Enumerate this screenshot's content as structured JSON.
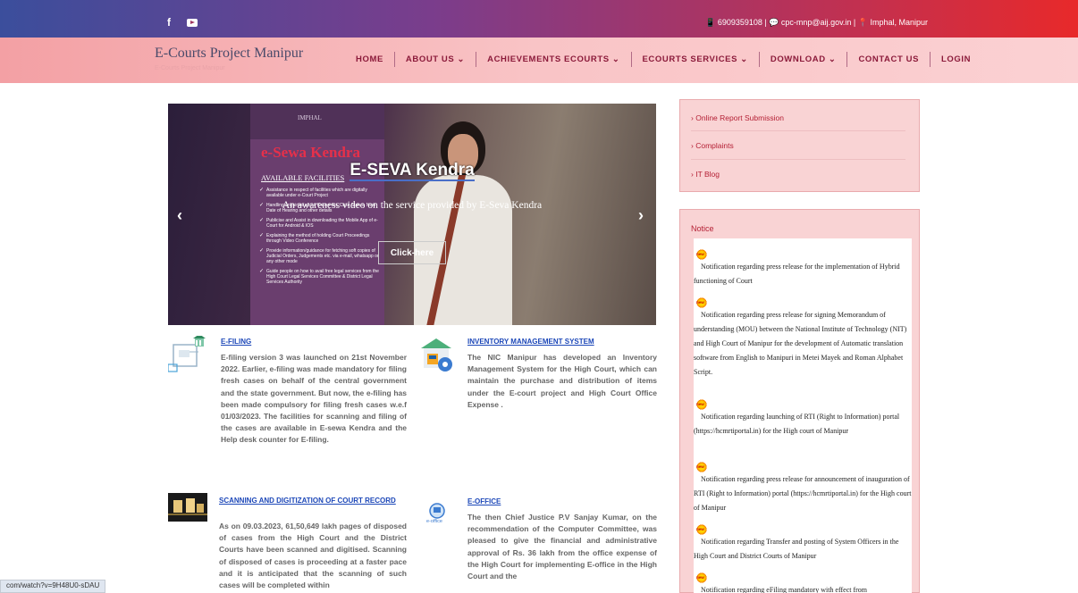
{
  "topbar": {
    "facebook_label": "f",
    "youtube_label": "",
    "phone": "6909359108",
    "email": "cpc-mnp@aij.gov.in",
    "location": "Imphal, Manipur",
    "info_text": "📱 6909359108 | 💬 cpc-mnp@aij.gov.in | 📍 Imphal, Manipur"
  },
  "nav": {
    "brand": "E-Courts Project Manipur",
    "brand_sub": "E-Courts Project Manipur",
    "items": [
      {
        "label": "HOME"
      },
      {
        "label": "ABOUT US ⌄"
      },
      {
        "label": "ACHIEVEMENTS ECOURTS ⌄"
      },
      {
        "label": "ECOURTS SERVICES ⌄"
      },
      {
        "label": "DOWNLOAD ⌄"
      },
      {
        "label": "CONTACT US"
      },
      {
        "label": "LOGIN"
      }
    ]
  },
  "slider": {
    "poster_top": "IMPHAL",
    "poster_title": "e-Sewa Kendra",
    "poster_heading": "AVAILABLE FACILITIES",
    "poster_items": [
      "Assistance in respect of facilities which are digitally available under e-Court Project",
      "Handling enquiries about Cause-list, Case Status, Next Date of Hearing and other details",
      "Publicise and Assist in downloading the Mobile App of e-Court for Android & IOS",
      "Explaining the method of holding Court Proceedings through Video Conference",
      "Provide information/guidance for fetching soft copies of Judicial Orders, Judgements etc. via e-mail, whatsapp or any other mode",
      "Guide people on how to avail free legal services from the High Court Legal Services Committee & District Legal Services Authority"
    ],
    "title": "E-SEVA Kendra",
    "subtitle": "An awareness video on the service provided by E-Seva Kendra",
    "button": "Click-here",
    "prev": "‹",
    "next": "›"
  },
  "cards": [
    {
      "title": "E-FILING",
      "text": "E-filing version 3 was launched on 21st November 2022. Earlier, e-filing was made mandatory for filing fresh cases on behalf of the central government and the state government. But now, the e-filing has been made compulsory for filing fresh cases w.e.f 01/03/2023. The facilities for scanning and filing of the cases are available in E-sewa Kendra and the Help desk counter for E-filing."
    },
    {
      "title": "INVENTORY MANAGEMENT SYSTEM",
      "text": "The NIC Manipur has developed an Inventory Management System for the High Court, which can maintain the purchase and distribution of items under the E-court project and High Court Office Expense ."
    },
    {
      "title": "SCANNING AND DIGITIZATION OF COURT RECORD",
      "text": "As on 09.03.2023, 61,50,649 lakh pages of disposed of cases from the High Court and the District Courts have been scanned and digitised. Scanning of disposed of cases is proceeding at a faster pace and it is anticipated that the scanning of such cases will be completed within"
    },
    {
      "title": "E-OFFICE",
      "icon_label": "e-office",
      "text": "The then Chief Justice P.V Sanjay Kumar, on the recommendation of the Computer Committee, was pleased to give the financial and administrative approval of Rs. 36 lakh from the office expense of the High Court for implementing E-office in the High Court and the"
    }
  ],
  "sidebar": {
    "links": [
      {
        "label": "Online Report Submission"
      },
      {
        "label": "Complaints"
      },
      {
        "label": "IT Blog"
      }
    ]
  },
  "notice": {
    "heading": "Notice",
    "items": [
      {
        "text": "Notification regarding press release for the implementation of Hybrid functioning of Court"
      },
      {
        "text": "Notification regarding press release for signing Memorandum of understanding (MOU) between the National Institute of Technology (NIT) and High Court of Manipur for the development of Automatic translation software from English to Manipuri in Metei Mayek and Roman Alphabet Script."
      },
      {
        "text": "Notification regarding launching of RTI (Right to Information) portal (https://hcmrtiportal.in) for the High court of Manipur"
      },
      {
        "text": "Notification regarding press release for announcement of inauguration of RTI (Right to Information) portal (https://hcmrtiportal.in) for the High court of Manipur"
      },
      {
        "text": "Notification regarding Transfer and posting of System Officers in the High Court and District Courts of Manipur"
      },
      {
        "text": "Notification regarding eFiling mandatory with effect from"
      }
    ]
  },
  "statusbar": {
    "url": "com/watch?v=9H48U0-sDAU"
  }
}
